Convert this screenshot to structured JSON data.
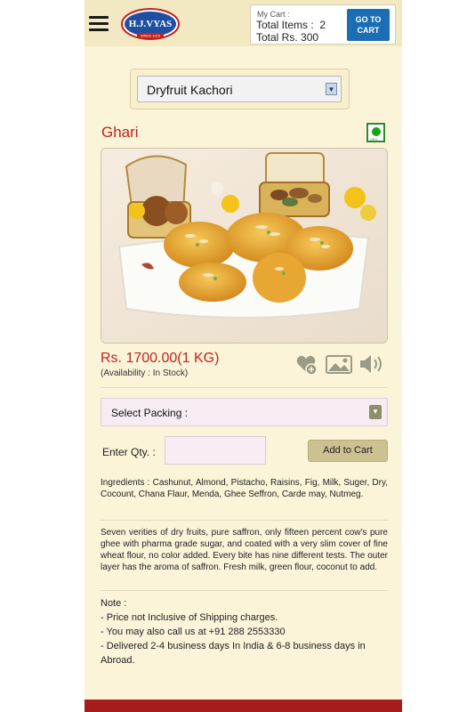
{
  "header": {
    "logo_text": "H.J.VYAS",
    "logo_subtext": "SINCE 1916",
    "cart": {
      "label": "My Cart :",
      "items_label": "Total Items :",
      "items_value": "2",
      "total_label": "Total Rs.",
      "total_value": "300",
      "goto_line1": "GO TO",
      "goto_line2": "CART"
    }
  },
  "category_select": {
    "selected": "Dryfruit Kachori"
  },
  "product": {
    "name": "Ghari",
    "veg_tag": "VEG",
    "price": "Rs. 1700.00(1 KG)",
    "availability": "(Availability : In Stock)"
  },
  "packing": {
    "placeholder": "Select Packing :"
  },
  "quantity": {
    "label": "Enter Qty. :",
    "value": ""
  },
  "add_to_cart": "Add to Cart",
  "ingredients": "Ingredients : Cashunut, Almond, Pistacho, Raisins, Fig, Milk, Suger, Dry, Cocount, Chana Flaur, Menda, Ghee Seffron, Carde may, Nutmeg.",
  "description": "Seven verities of dry fruits, pure saffron, only fifteen percent cow's pure ghee with pharma grade sugar, and coated with a very slim cover of fine wheat flour, no color added. Every bite has nine different tests. The outer layer has the aroma of saffron. Fresh milk, green flour, coconut to add.",
  "note": {
    "title": "Note :",
    "items": [
      "-  Price not Inclusive of Shipping charges.",
      "-  You may also call us at +91 288 2553330",
      "-  Delivered 2-4 business days In India & 6-8 business days in",
      "Abroad."
    ]
  },
  "icons": [
    "hamburger-menu-icon",
    "wishlist-add-icon",
    "gallery-icon",
    "speaker-icon",
    "dropdown-arrow-icon",
    "veg-mark-icon"
  ],
  "colors": {
    "accent_red": "#c2221e",
    "cart_button": "#1b6db4",
    "page_bg": "#fbf4d9",
    "footer": "#a61c1c"
  }
}
